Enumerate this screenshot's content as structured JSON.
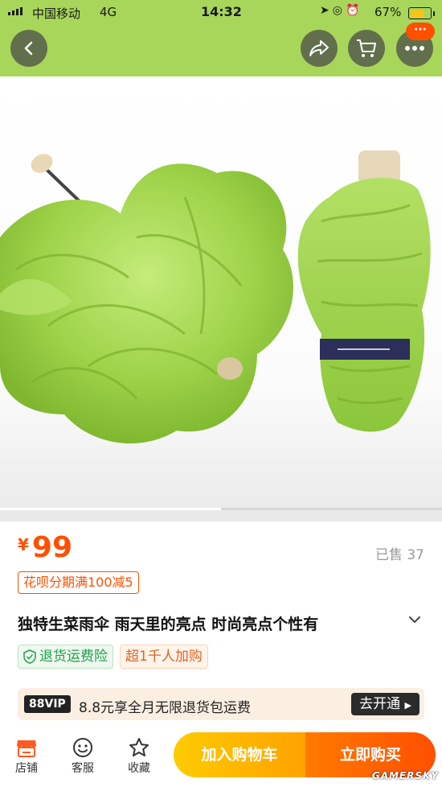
{
  "status_bar": {
    "carrier": "中国移动",
    "network": "4G",
    "time": "14:32",
    "battery": "67%"
  },
  "nav": {
    "cart_badge": "···"
  },
  "product": {
    "currency": "¥",
    "price": "99",
    "sold": "已售 37",
    "promo": "花呗分期满100减5",
    "title": "独特生菜雨伞 雨天里的亮点 时尚亮点个性有",
    "tags": [
      "退货运费险",
      "超1千人加购"
    ]
  },
  "vip": {
    "badge": "88VIP",
    "text": "8.8元享全月无限退货包运费",
    "button": "去开通"
  },
  "bottom_bar": {
    "shop": "店铺",
    "service": "客服",
    "favorite": "收藏",
    "add_cart": "加入购物车",
    "buy_now": "立即购买"
  },
  "watermark": "GAMERSKY",
  "colors": {
    "accent": "#ff5000",
    "header_green": "#a8d65a"
  },
  "gallery": {
    "progress": 0.5
  }
}
